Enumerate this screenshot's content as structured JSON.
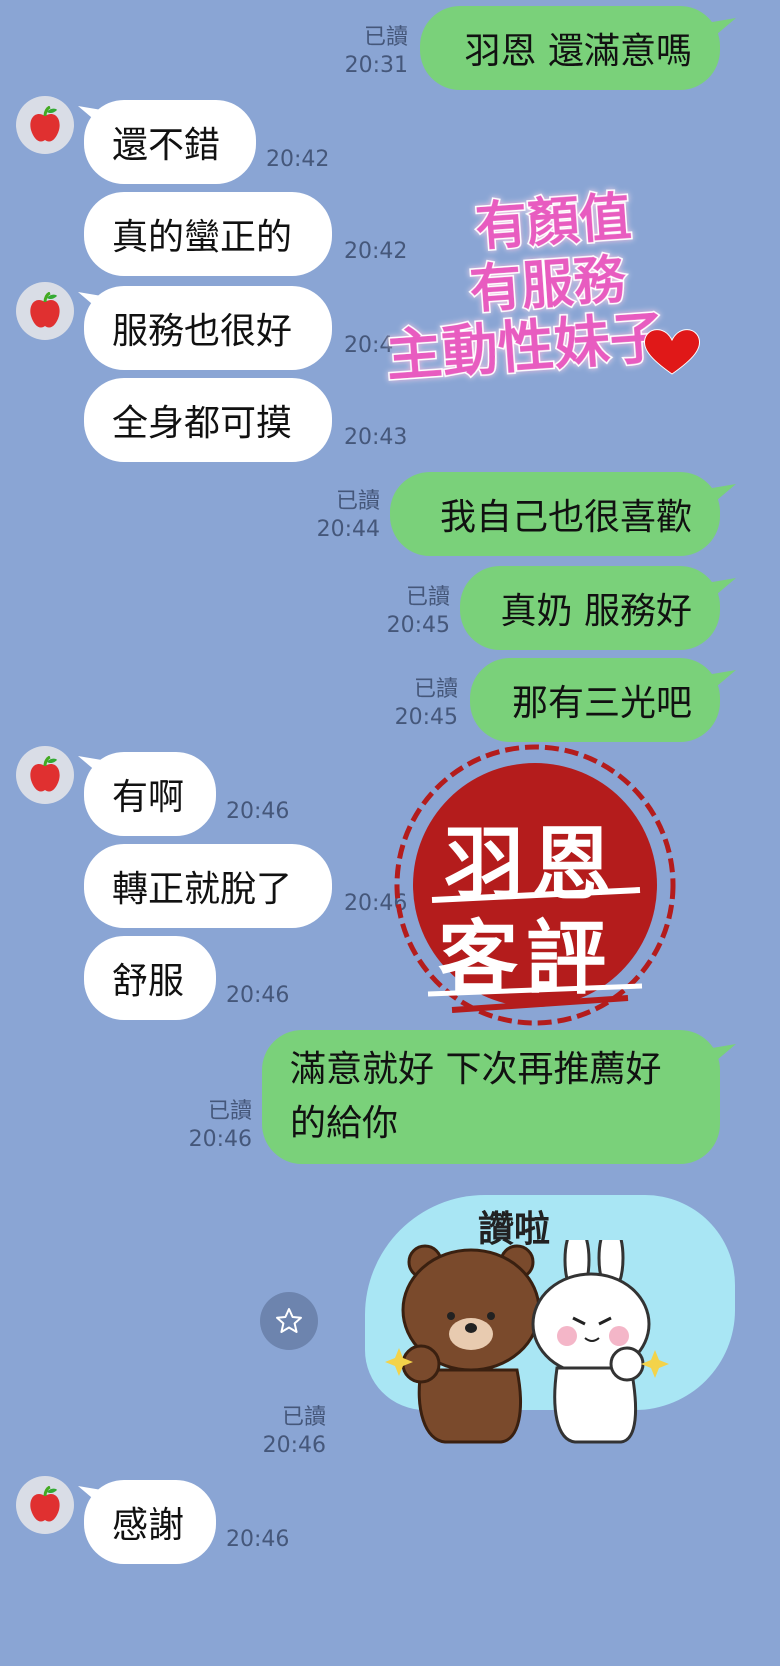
{
  "read_label": "已讀",
  "messages": [
    {
      "text": "羽恩 還滿意嗎",
      "time": "20:31"
    },
    {
      "text": "還不錯",
      "time": "20:42"
    },
    {
      "text": "真的蠻正的",
      "time": "20:42"
    },
    {
      "text": "服務也很好",
      "time": "20:4"
    },
    {
      "text": "全身都可摸",
      "time": "20:43"
    },
    {
      "text": "我自己也很喜歡",
      "time": "20:44"
    },
    {
      "text": "真奶 服務好",
      "time": "20:45"
    },
    {
      "text": "那有三光吧",
      "time": "20:45"
    },
    {
      "text": "有啊",
      "time": "20:46"
    },
    {
      "text": "轉正就脫了",
      "time": "20:46"
    },
    {
      "text": "舒服",
      "time": "20:46"
    },
    {
      "text": "滿意就好 下次再推薦好的給你",
      "time": "20:46"
    },
    {
      "text": "",
      "time": "20:46"
    },
    {
      "text": "感謝",
      "time": "20:46"
    }
  ],
  "overlay": {
    "line1": "有顏值",
    "line2": "有服務",
    "line3": "主動性妹子",
    "seal_line1": "羽恩",
    "seal_line2": "客評"
  },
  "sticker": {
    "caption": "讚啦"
  },
  "colors": {
    "background": "#8aa5d4",
    "outgoing": "#7ad17a",
    "incoming": "#ffffff",
    "seal": "#b41c1c"
  }
}
